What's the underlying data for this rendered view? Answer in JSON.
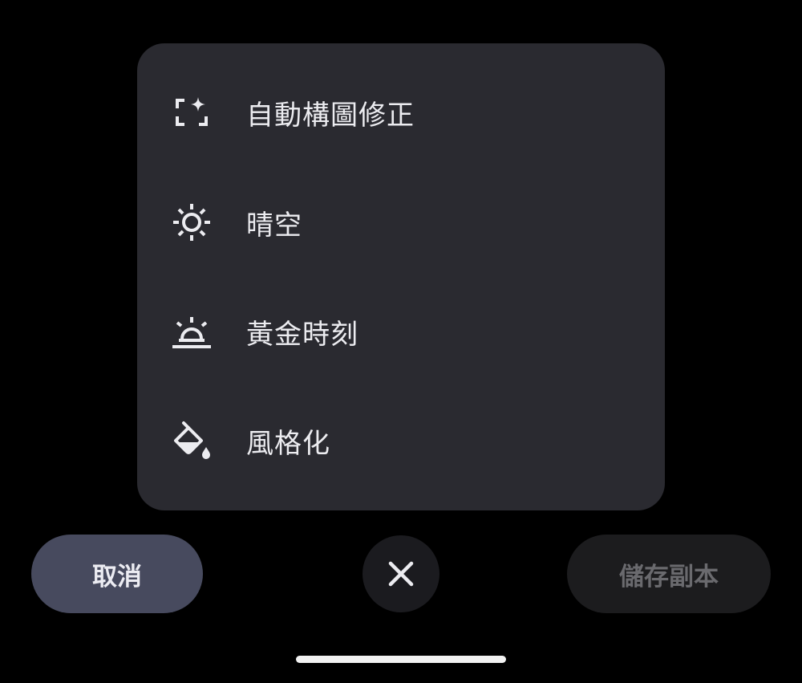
{
  "menu": {
    "items": [
      {
        "label": "自動構圖修正",
        "icon": "auto-frame-sparkle-icon"
      },
      {
        "label": "晴空",
        "icon": "sun-icon"
      },
      {
        "label": "黃金時刻",
        "icon": "sunrise-icon"
      },
      {
        "label": "風格化",
        "icon": "paint-bucket-icon"
      }
    ]
  },
  "actions": {
    "cancel_label": "取消",
    "close_icon": "close-icon",
    "save_copy_label": "儲存副本"
  },
  "colors": {
    "background": "#000000",
    "panel": "#2a2a30",
    "cancel_button": "#474a5e",
    "close_button": "#1b1b1f",
    "save_button_disabled": "#1c1c1e",
    "text_primary": "#ececf0",
    "text_disabled": "#6a6a6e"
  }
}
